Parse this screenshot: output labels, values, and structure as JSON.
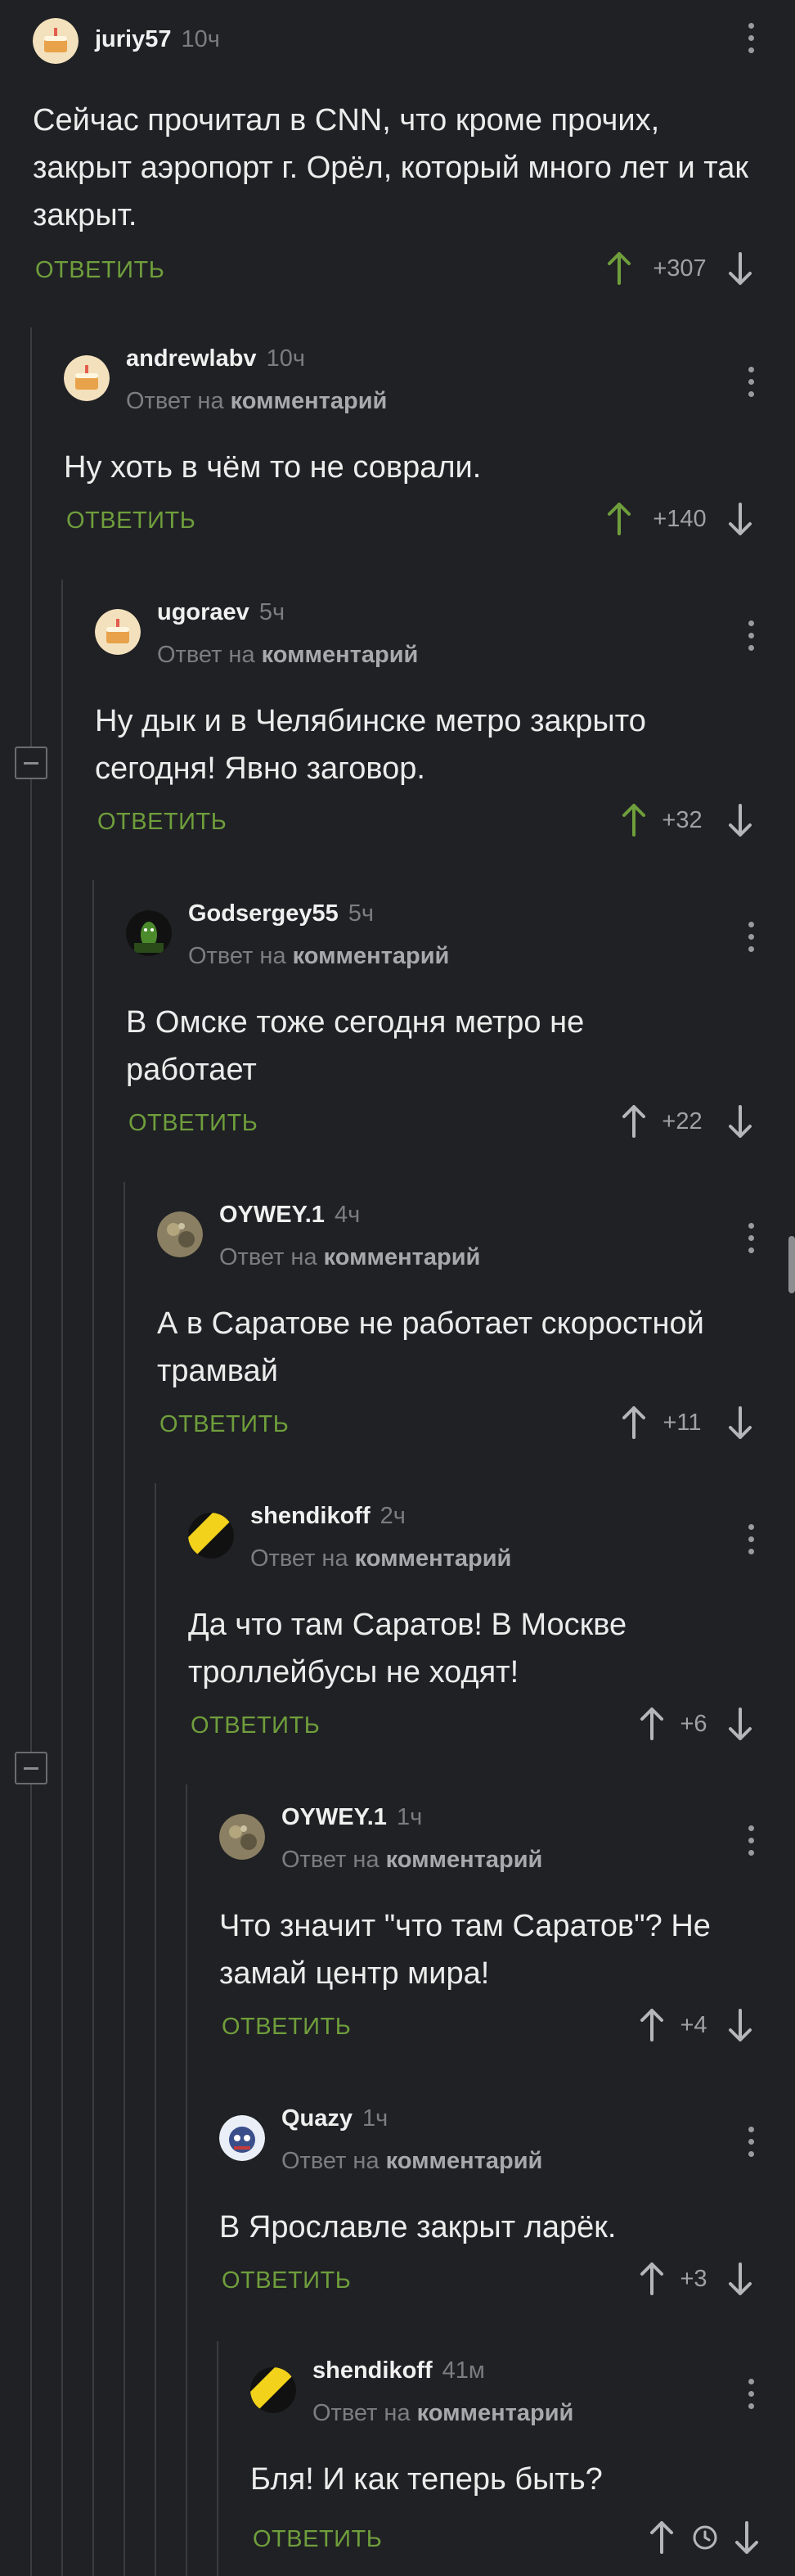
{
  "reply_label": "ОТВЕТИТЬ",
  "reply_to_prefix": "Ответ на",
  "reply_to_target": "комментарий",
  "comments": [
    {
      "username": "juriy57",
      "time": "10ч",
      "text": "Сейчас прочитал в CNN, что кроме прочих, закрыт аэропорт г. Орёл, который много лет и так закрыт.",
      "score": "+307",
      "upvoted": true,
      "avatar": "cake-icon"
    },
    {
      "username": "andrewlabv",
      "time": "10ч",
      "text": "Ну хоть в чём то не соврали.",
      "score": "+140",
      "upvoted": true,
      "avatar": "cake-icon"
    },
    {
      "username": "ugoraev",
      "time": "5ч",
      "text": "Ну дык и в Челябинске метро закрыто сегодня! Явно заговор.",
      "score": "+32",
      "upvoted": true,
      "avatar": "cake-icon"
    },
    {
      "username": "Godsergey55",
      "time": "5ч",
      "text": "В Омске тоже сегодня метро не работает",
      "score": "+22",
      "upvoted": false,
      "avatar": "character-icon"
    },
    {
      "username": "OYWEY.1",
      "time": "4ч",
      "text": "А в Саратове не работает скоростной трамвай",
      "score": "+11",
      "upvoted": false,
      "avatar": "photo-icon"
    },
    {
      "username": "shendikoff",
      "time": "2ч",
      "text": "Да что там Саратов! В Москве троллейбусы не ходят!",
      "score": "+6",
      "upvoted": false,
      "avatar": "hazard-icon"
    },
    {
      "username": "OYWEY.1",
      "time": "1ч",
      "text": "Что значит \"что там Саратов\"? Не замай центр мира!",
      "score": "+4",
      "upvoted": false,
      "avatar": "photo-icon"
    },
    {
      "username": "Quazy",
      "time": "1ч",
      "text": "В Ярославле закрыт ларёк.",
      "score": "+3",
      "upvoted": false,
      "avatar": "robot-icon"
    },
    {
      "username": "shendikoff",
      "time": "41м",
      "text": "Бля! И как теперь быть?",
      "score": "",
      "pending": true,
      "upvoted": false,
      "avatar": "hazard-icon"
    }
  ],
  "colors": {
    "background": "#202124",
    "reply_green": "#6f9e3c",
    "upvote_green": "#6f9e3c",
    "thread_line": "#3b3c3f"
  }
}
